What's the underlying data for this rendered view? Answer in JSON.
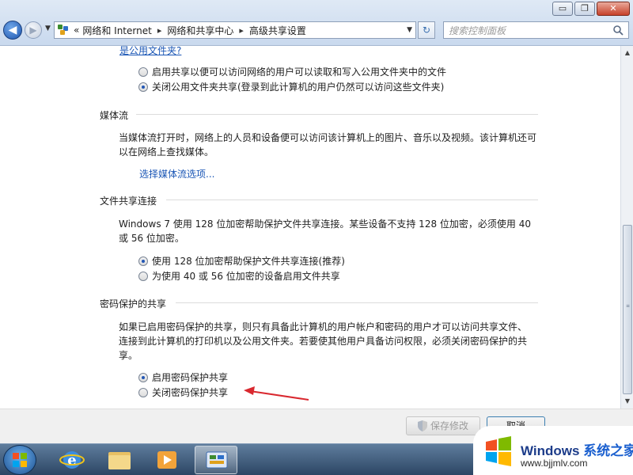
{
  "window": {
    "controls": {
      "minimize": "▭",
      "maximize": "❐",
      "close": "✕"
    }
  },
  "nav": {
    "back_icon": "back-arrow-icon",
    "forward_icon": "forward-arrow-icon"
  },
  "address": {
    "prefix": "«",
    "crumbs": [
      "网络和 Internet",
      "网络和共享中心",
      "高级共享设置"
    ],
    "sep": "▸"
  },
  "search": {
    "placeholder": "搜索控制面板"
  },
  "content": {
    "top_link": "是公用文件夹?",
    "public_folder": {
      "options": [
        {
          "label": "启用共享以便可以访问网络的用户可以读取和写入公用文件夹中的文件",
          "selected": false
        },
        {
          "label": "关闭公用文件夹共享(登录到此计算机的用户仍然可以访问这些文件夹)",
          "selected": true
        }
      ]
    },
    "media": {
      "title": "媒体流",
      "desc": "当媒体流打开时，网络上的人员和设备便可以访问该计算机上的图片、音乐以及视频。该计算机还可以在网络上查找媒体。",
      "link": "选择媒体流选项..."
    },
    "file_sharing": {
      "title": "文件共享连接",
      "desc": "Windows 7 使用 128 位加密帮助保护文件共享连接。某些设备不支持 128 位加密，必须使用 40 或 56 位加密。",
      "options": [
        {
          "label": "使用 128 位加密帮助保护文件共享连接(推荐)",
          "selected": true
        },
        {
          "label": "为使用 40 或 56 位加密的设备启用文件共享",
          "selected": false
        }
      ]
    },
    "password": {
      "title": "密码保护的共享",
      "desc": "如果已启用密码保护的共享，则只有具备此计算机的用户帐户和密码的用户才可以访问共享文件、连接到此计算机的打印机以及公用文件夹。若要使其他用户具备访问权限，必须关闭密码保护的共享。",
      "options": [
        {
          "label": "启用密码保护共享",
          "selected": true
        },
        {
          "label": "关闭密码保护共享",
          "selected": false
        }
      ]
    }
  },
  "buttons": {
    "save": "保存修改",
    "cancel": "取消"
  },
  "watermark": {
    "brand": "Windows",
    "brand_cn": "系统之家",
    "url": "www.bjjmlv.com"
  },
  "colors": {
    "link": "#1a56b5",
    "arrow": "#d9282f",
    "accent": "#2257b5"
  }
}
